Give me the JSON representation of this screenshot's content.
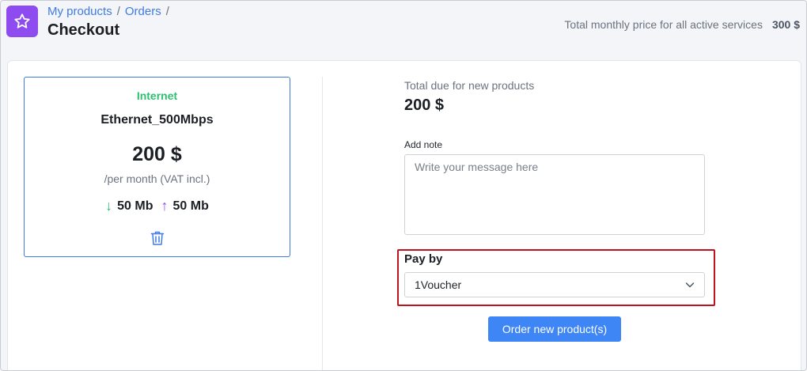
{
  "header": {
    "breadcrumb": [
      {
        "label": "My products"
      },
      {
        "label": "Orders"
      }
    ],
    "breadcrumb_separator": "/",
    "title": "Checkout",
    "total_monthly_label": "Total monthly price for all active services",
    "total_monthly_value": "300 $",
    "app_icon": "star-icon"
  },
  "product": {
    "category": "Internet",
    "name": "Ethernet_500Mbps",
    "price": "200 $",
    "period": "/per month (VAT incl.)",
    "download": "50 Mb",
    "upload": "50 Mb",
    "delete_icon": "trash-icon"
  },
  "summary": {
    "due_label": "Total due for new products",
    "due_amount": "200 $"
  },
  "note": {
    "label": "Add note",
    "placeholder": "Write your message here",
    "value": ""
  },
  "payment": {
    "label": "Pay by",
    "selected": "1Voucher"
  },
  "actions": {
    "order_label": "Order new product(s)"
  },
  "colors": {
    "accent": "#3e86f5",
    "brand_purple": "#8e4cf0",
    "category_green": "#2fbf71",
    "highlight_red": "#c0121a"
  }
}
